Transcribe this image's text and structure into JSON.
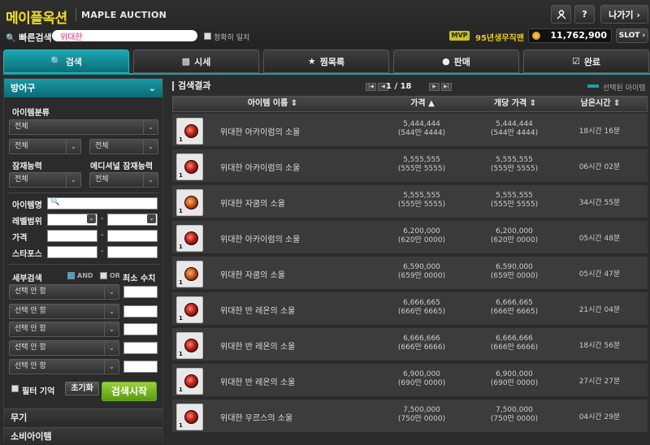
{
  "header": {
    "logo": "메이플옥션",
    "subtitle": "MAPLE AUCTION",
    "btn_profile_icon": "person-icon",
    "btn_help": "?",
    "btn_exit": "나가기 ›",
    "quick_search_label": "빠른검색",
    "quick_search_value": "위대한",
    "exact_match_label": "정확히 일치",
    "mvp_badge": "MVP",
    "player_name": "95년생무직맨",
    "meso": "11,762,900",
    "slot_button": "SLOT ›"
  },
  "tabs": [
    {
      "label": "검색",
      "icon": "search-icon"
    },
    {
      "label": "시세",
      "icon": "chart-icon"
    },
    {
      "label": "찜목록",
      "icon": "star-icon"
    },
    {
      "label": "판매",
      "icon": "sell-icon"
    },
    {
      "label": "완료",
      "icon": "check-icon"
    }
  ],
  "sidebar": {
    "section_title": "방어구",
    "item_category_label": "아이템분류",
    "category_all": "전체",
    "sub1": "전체",
    "sub2": "전체",
    "potential_label": "잠재능력",
    "additional_potential_label": "에디셔널 잠재능력",
    "potential_value": "전체",
    "additional_potential_value": "전체",
    "item_name_label": "아이템명",
    "level_range_label": "레벨범위",
    "price_label": "가격",
    "starforce_label": "스타포스",
    "detail_search_label": "세부검색",
    "and_label": "AND",
    "or_label": "OR",
    "min_value_label": "최소 수치",
    "option_selects": [
      "선택 안 함",
      "선택 안 함",
      "선택 안 함",
      "선택 안 함",
      "선택 안 함"
    ],
    "filter_memory_label": "필터 기억",
    "reset_button": "초기화",
    "search_button": "검색시작",
    "categories": [
      "무기",
      "소비아이템"
    ]
  },
  "results": {
    "title": "검색결과",
    "page": "1 / 18",
    "legend": "선택된 아이템",
    "columns": [
      "아이템 이름 ⇕",
      "가격 ▲",
      "개당 가격 ⇕",
      "남은시간 ⇕"
    ],
    "rows": [
      {
        "name": "위대한 아카이럼의 소울",
        "price": "5,444,444",
        "price_sub": "(544만 4444)",
        "unit": "5,444,444",
        "unit_sub": "(544만 4444)",
        "time": "18시간 16분",
        "qty": "1"
      },
      {
        "name": "위대한 아카이럼의 소울",
        "price": "5,555,555",
        "price_sub": "(555만 5555)",
        "unit": "5,555,555",
        "unit_sub": "(555만 5555)",
        "time": "06시간 02분",
        "qty": "1"
      },
      {
        "name": "위대한 자쿰의 소울",
        "price": "5,555,555",
        "price_sub": "(555만 5555)",
        "unit": "5,555,555",
        "unit_sub": "(555만 5555)",
        "time": "34시간 55분",
        "qty": "1"
      },
      {
        "name": "위대한 아카이럼의 소울",
        "price": "6,200,000",
        "price_sub": "(620만 0000)",
        "unit": "6,200,000",
        "unit_sub": "(620만 0000)",
        "time": "05시간 48분",
        "qty": "1"
      },
      {
        "name": "위대한 자쿰의 소울",
        "price": "6,590,000",
        "price_sub": "(659만 0000)",
        "unit": "6,590,000",
        "unit_sub": "(659만 0000)",
        "time": "05시간 47분",
        "qty": "1"
      },
      {
        "name": "위대한 반 레온의 소울",
        "price": "6,666,665",
        "price_sub": "(666만 6665)",
        "unit": "6,666,665",
        "unit_sub": "(666만 6665)",
        "time": "21시간 04분",
        "qty": "1"
      },
      {
        "name": "위대한 반 레온의 소울",
        "price": "6,666,666",
        "price_sub": "(666만 6666)",
        "unit": "6,666,666",
        "unit_sub": "(666만 6666)",
        "time": "18시간 56분",
        "qty": "1"
      },
      {
        "name": "위대한 반 레온의 소울",
        "price": "6,900,000",
        "price_sub": "(690만 0000)",
        "unit": "6,900,000",
        "unit_sub": "(690만 0000)",
        "time": "27시간 27분",
        "qty": "1"
      },
      {
        "name": "위대한 우르스의 소울",
        "price": "7,500,000",
        "price_sub": "(750만 0000)",
        "unit": "7,500,000",
        "unit_sub": "(750만 0000)",
        "time": "04시간 29분",
        "qty": "1"
      }
    ]
  },
  "colors": {
    "accent": "#1aa0a8",
    "logo": "#f0e020",
    "search_button": "#7ab830"
  }
}
